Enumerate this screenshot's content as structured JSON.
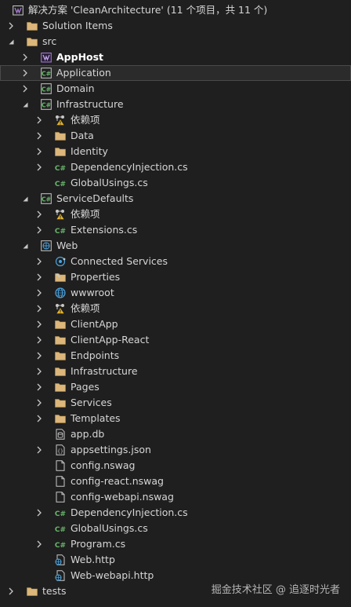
{
  "colors": {
    "background": "#1f1f1f",
    "folder": "#dcb67a",
    "csharp_green": "#67b56b",
    "vs_purple": "#a87ed6",
    "text": "#d6d6d6"
  },
  "tree": [
    {
      "label": "解决方案 'CleanArchitecture' (11 个项目，共 11 个)",
      "icon": "solution-icon",
      "level": 0,
      "expand": "none"
    },
    {
      "label": "Solution Items",
      "icon": "folder-icon",
      "level": 0,
      "expand": "collapsed"
    },
    {
      "label": "src",
      "icon": "folder-icon",
      "level": 0,
      "expand": "expanded"
    },
    {
      "label": "AppHost",
      "icon": "apphost-project-icon",
      "level": 1,
      "expand": "collapsed",
      "bold": true
    },
    {
      "label": "Application",
      "icon": "csharp-project-icon",
      "level": 1,
      "expand": "collapsed",
      "selected": true
    },
    {
      "label": "Domain",
      "icon": "csharp-project-icon",
      "level": 1,
      "expand": "collapsed"
    },
    {
      "label": "Infrastructure",
      "icon": "csharp-project-icon",
      "level": 1,
      "expand": "expanded"
    },
    {
      "label": "依赖项",
      "icon": "dependencies-warning-icon",
      "level": 2,
      "expand": "collapsed"
    },
    {
      "label": "Data",
      "icon": "folder-icon",
      "level": 2,
      "expand": "collapsed"
    },
    {
      "label": "Identity",
      "icon": "folder-icon",
      "level": 2,
      "expand": "collapsed"
    },
    {
      "label": "DependencyInjection.cs",
      "icon": "csharp-file-icon",
      "level": 2,
      "expand": "collapsed"
    },
    {
      "label": "GlobalUsings.cs",
      "icon": "csharp-file-icon",
      "level": 2,
      "expand": "none"
    },
    {
      "label": "ServiceDefaults",
      "icon": "csharp-project-icon",
      "level": 1,
      "expand": "expanded"
    },
    {
      "label": "依赖项",
      "icon": "dependencies-warning-icon",
      "level": 2,
      "expand": "collapsed"
    },
    {
      "label": "Extensions.cs",
      "icon": "csharp-file-icon",
      "level": 2,
      "expand": "collapsed"
    },
    {
      "label": "Web",
      "icon": "web-project-icon",
      "level": 1,
      "expand": "expanded"
    },
    {
      "label": "Connected Services",
      "icon": "connected-services-icon",
      "level": 2,
      "expand": "collapsed"
    },
    {
      "label": "Properties",
      "icon": "properties-icon",
      "level": 2,
      "expand": "collapsed"
    },
    {
      "label": "wwwroot",
      "icon": "globe-icon",
      "level": 2,
      "expand": "collapsed"
    },
    {
      "label": "依赖项",
      "icon": "dependencies-warning-icon",
      "level": 2,
      "expand": "collapsed"
    },
    {
      "label": "ClientApp",
      "icon": "folder-icon",
      "level": 2,
      "expand": "collapsed"
    },
    {
      "label": "ClientApp-React",
      "icon": "folder-icon",
      "level": 2,
      "expand": "collapsed"
    },
    {
      "label": "Endpoints",
      "icon": "folder-icon",
      "level": 2,
      "expand": "collapsed"
    },
    {
      "label": "Infrastructure",
      "icon": "folder-icon",
      "level": 2,
      "expand": "collapsed"
    },
    {
      "label": "Pages",
      "icon": "folder-icon",
      "level": 2,
      "expand": "collapsed"
    },
    {
      "label": "Services",
      "icon": "folder-icon",
      "level": 2,
      "expand": "collapsed"
    },
    {
      "label": "Templates",
      "icon": "folder-icon",
      "level": 2,
      "expand": "collapsed"
    },
    {
      "label": "app.db",
      "icon": "database-file-icon",
      "level": 2,
      "expand": "none"
    },
    {
      "label": "appsettings.json",
      "icon": "json-file-icon",
      "level": 2,
      "expand": "collapsed"
    },
    {
      "label": "config.nswag",
      "icon": "file-icon",
      "level": 2,
      "expand": "none"
    },
    {
      "label": "config-react.nswag",
      "icon": "file-icon",
      "level": 2,
      "expand": "none"
    },
    {
      "label": "config-webapi.nswag",
      "icon": "file-icon",
      "level": 2,
      "expand": "none"
    },
    {
      "label": "DependencyInjection.cs",
      "icon": "csharp-file-icon",
      "level": 2,
      "expand": "collapsed"
    },
    {
      "label": "GlobalUsings.cs",
      "icon": "csharp-file-icon",
      "level": 2,
      "expand": "none"
    },
    {
      "label": "Program.cs",
      "icon": "csharp-file-icon",
      "level": 2,
      "expand": "collapsed"
    },
    {
      "label": "Web.http",
      "icon": "http-file-icon",
      "level": 2,
      "expand": "none"
    },
    {
      "label": "Web-webapi.http",
      "icon": "http-file-icon",
      "level": 2,
      "expand": "none"
    },
    {
      "label": "tests",
      "icon": "folder-icon",
      "level": 0,
      "expand": "collapsed"
    }
  ],
  "watermark": "掘金技术社区 @ 追逐时光者"
}
